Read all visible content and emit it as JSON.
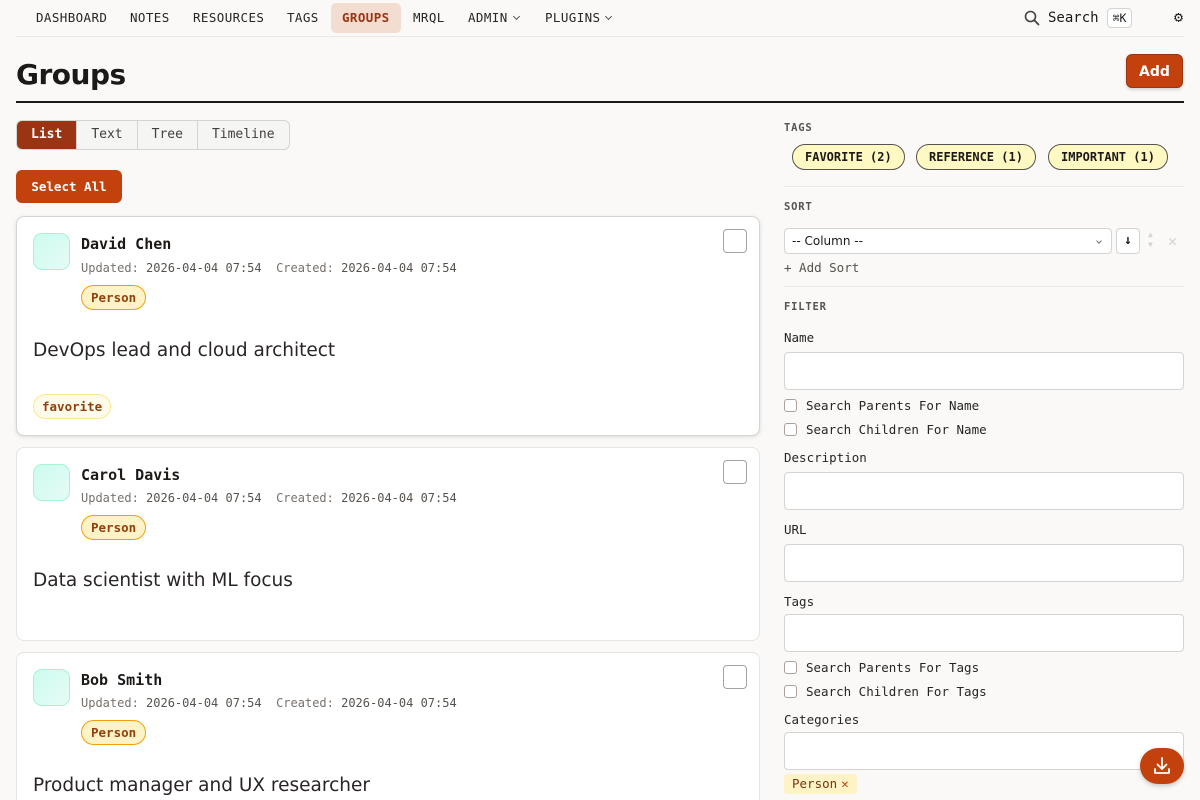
{
  "nav": {
    "items": [
      {
        "label": "DASHBOARD"
      },
      {
        "label": "NOTES"
      },
      {
        "label": "RESOURCES"
      },
      {
        "label": "TAGS"
      },
      {
        "label": "GROUPS"
      },
      {
        "label": "MRQL"
      },
      {
        "label": "ADMIN"
      },
      {
        "label": "PLUGINS"
      }
    ],
    "search_label": "Search",
    "shortcut": "⌘K"
  },
  "page": {
    "title": "Groups",
    "add_label": "Add"
  },
  "views": {
    "tabs": [
      "List",
      "Text",
      "Tree",
      "Timeline"
    ],
    "active": "List"
  },
  "select_all_label": "Select All",
  "groups": [
    {
      "name": "David Chen",
      "updated_label": "Updated:",
      "updated": "2026-04-04 07:54",
      "created_label": "Created:",
      "created": "2026-04-04 07:54",
      "category": "Person",
      "description": "DevOps lead and cloud architect",
      "tag": "favorite"
    },
    {
      "name": "Carol Davis",
      "updated_label": "Updated:",
      "updated": "2026-04-04 07:54",
      "created_label": "Created:",
      "created": "2026-04-04 07:54",
      "category": "Person",
      "description": "Data scientist with ML focus"
    },
    {
      "name": "Bob Smith",
      "updated_label": "Updated:",
      "updated": "2026-04-04 07:54",
      "created_label": "Created:",
      "created": "2026-04-04 07:54",
      "category": "Person",
      "description": "Product manager and UX researcher"
    }
  ],
  "sidebar": {
    "tags_heading": "TAGS",
    "tags": [
      "FAVORITE (2)",
      "REFERENCE (1)",
      "IMPORTANT (1)"
    ],
    "sort_heading": "SORT",
    "sort_placeholder": "-- Column --",
    "sort_direction": "↓",
    "add_sort": "+ Add Sort",
    "filter_heading": "FILTER",
    "name_label": "Name",
    "search_parents_name": "Search Parents For Name",
    "search_children_name": "Search Children For Name",
    "description_label": "Description",
    "url_label": "URL",
    "tags_label": "Tags",
    "search_parents_tags": "Search Parents For Tags",
    "search_children_tags": "Search Children For Tags",
    "categories_label": "Categories",
    "selected_category": "Person"
  },
  "colors": {
    "accent": "#c2410c",
    "accent_dark": "#9a3412",
    "badge_bg": "#fef3c7"
  }
}
